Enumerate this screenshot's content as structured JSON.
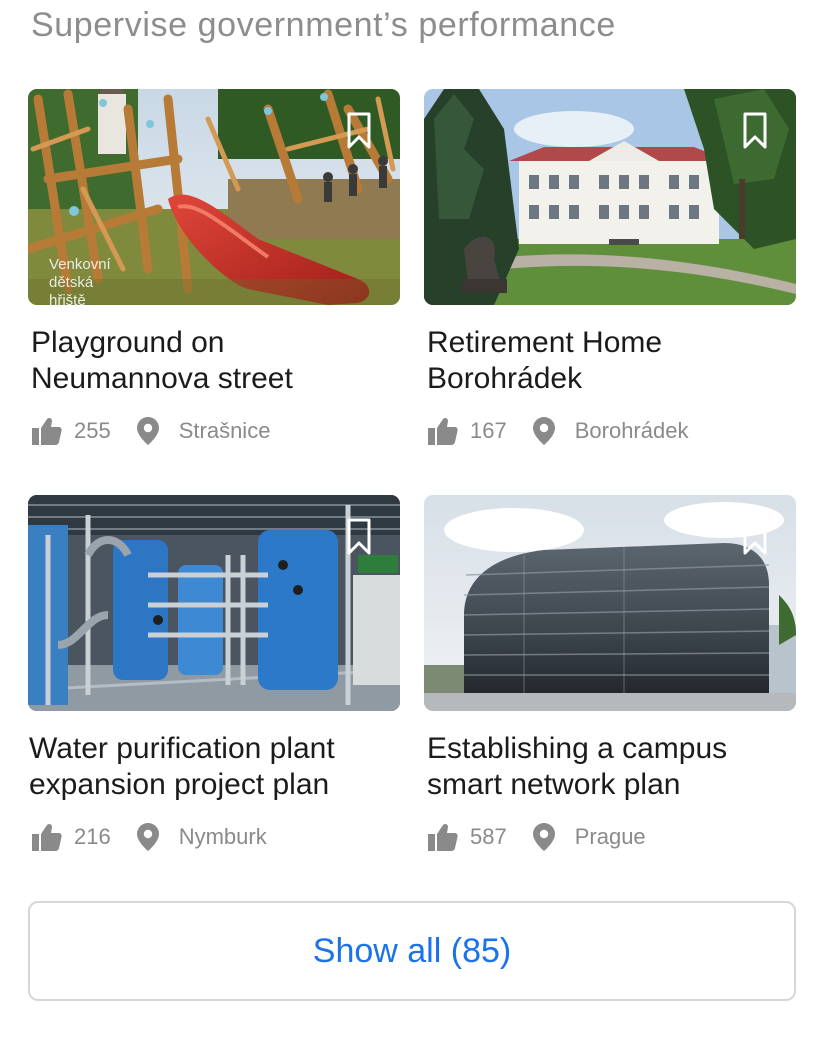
{
  "section": {
    "title": "Supervise government’s performance"
  },
  "cards": [
    {
      "name": "Playground on Neumannova street",
      "likes": "255",
      "location": "Strašnice",
      "photo_caption": "Venkovní dětská hřiště",
      "image": "wooden-playground-slide-photo",
      "icons": {
        "bookmark": "bookmark-icon",
        "like": "thumbs-up-icon",
        "location": "map-pin-icon"
      }
    },
    {
      "name": "Retirement Home Borohrádek",
      "likes": "167",
      "location": "Borohrádek",
      "image": "white-manor-building-park-photo",
      "icons": {
        "bookmark": "bookmark-icon",
        "like": "thumbs-up-icon",
        "location": "map-pin-icon"
      }
    },
    {
      "name": "Water purification plant expansion project plan",
      "likes": "216",
      "location": "Nymburk",
      "image": "blue-water-treatment-tanks-photo",
      "icons": {
        "bookmark": "bookmark-icon",
        "like": "thumbs-up-icon",
        "location": "map-pin-icon"
      }
    },
    {
      "name": "Establishing a campus smart network plan",
      "likes": "587",
      "location": "Prague",
      "image": "glass-campus-building-photo",
      "icons": {
        "bookmark": "bookmark-icon",
        "like": "thumbs-up-icon",
        "location": "map-pin-icon"
      }
    }
  ],
  "show_all": {
    "label": "Show all (85)"
  },
  "colors": {
    "title": "#8d8d8d",
    "card_title": "#1b1b1b",
    "meta": "#8a8a8a",
    "link": "#1a73e8",
    "button_border": "#d6d6d6"
  }
}
